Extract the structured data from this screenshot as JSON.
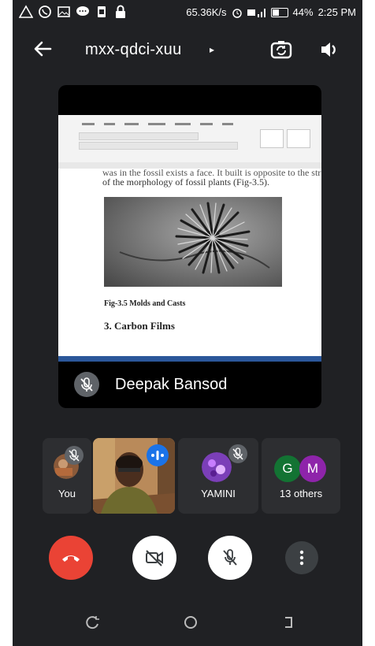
{
  "status_bar": {
    "speed": "65.36K/s",
    "battery": "44%",
    "time": "2:25 PM",
    "icons": [
      "alert-icon",
      "whatsapp-icon",
      "gallery-icon",
      "chat-icon",
      "sim-icon",
      "lock-icon",
      "alarm-icon",
      "signal-icon",
      "battery-icon"
    ]
  },
  "meeting": {
    "title": "mxx-qdci-xuu",
    "caret": "▸"
  },
  "presentation": {
    "doc_line_top": "was in the fossil exists a face. It built is opposite to the structure",
    "doc_line": "of the morphology of fossil plants (Fig-3.5).",
    "figure_caption": "Fig-3.5 Molds and Casts",
    "section_heading": "3. Carbon Films",
    "presenter_name": "Deepak Bansod"
  },
  "participants": [
    {
      "label": "You"
    },
    {
      "label": ""
    },
    {
      "label": "YAMINI"
    },
    {
      "label": "13 others",
      "avatars": [
        "G",
        "M"
      ]
    }
  ],
  "colors": {
    "background": "#202124",
    "tile": "#2d2e31",
    "end_call": "#ea4335",
    "speaking_badge": "#1a73e8",
    "avatar_g": "#137333",
    "avatar_m": "#8e24aa"
  }
}
